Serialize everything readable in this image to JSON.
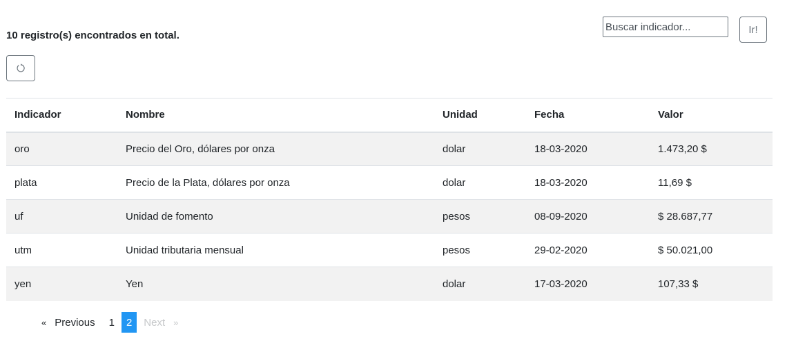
{
  "summary": "10 registro(s) encontrados en total.",
  "search": {
    "placeholder": "Buscar indicador...",
    "button_label": "Ir!"
  },
  "refresh": {
    "icon": "refresh-icon"
  },
  "table": {
    "headers": [
      "Indicador",
      "Nombre",
      "Unidad",
      "Fecha",
      "Valor"
    ],
    "rows": [
      [
        "oro",
        "Precio del Oro, dólares por onza",
        "dolar",
        "18-03-2020",
        "1.473,20 $"
      ],
      [
        "plata",
        "Precio de la Plata, dólares por onza",
        "dolar",
        "18-03-2020",
        "11,69 $"
      ],
      [
        "uf",
        "Unidad de fomento",
        "pesos",
        "08-09-2020",
        "$ 28.687,77"
      ],
      [
        "utm",
        "Unidad tributaria mensual",
        "pesos",
        "29-02-2020",
        "$ 50.021,00"
      ],
      [
        "yen",
        "Yen",
        "dolar",
        "17-03-2020",
        "107,33 $"
      ]
    ]
  },
  "pagination": {
    "prev_arrow": "«",
    "previous": "Previous",
    "pages": [
      "1",
      "2"
    ],
    "current_page": "2",
    "next": "Next",
    "next_arrow": "»"
  },
  "colors": {
    "active_page": "#2196f3",
    "stripe": "#f2f2f2",
    "border": "#dee2e6"
  }
}
